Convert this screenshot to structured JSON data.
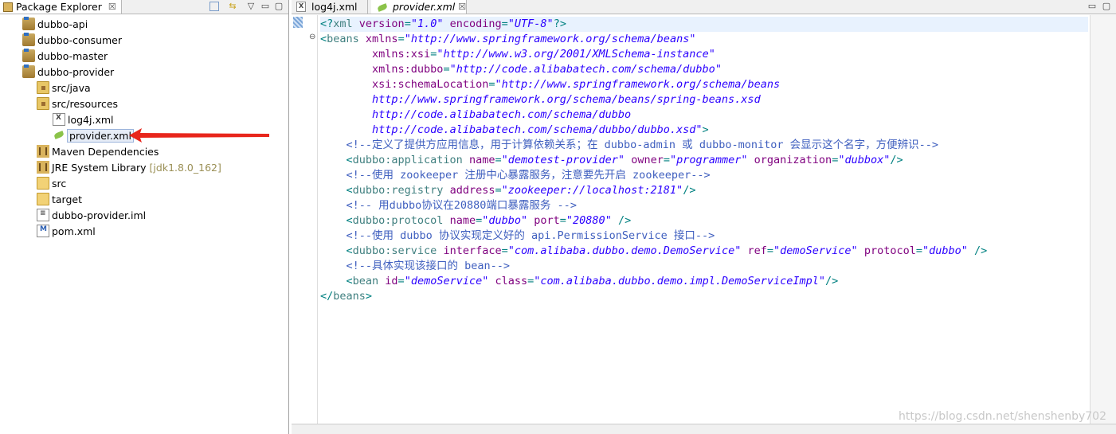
{
  "explorer": {
    "title": "Package Explorer",
    "close_glyph": "☒",
    "items": [
      {
        "label": "dubbo-api",
        "icon": "project-icon"
      },
      {
        "label": "dubbo-consumer",
        "icon": "project-icon"
      },
      {
        "label": "dubbo-master",
        "icon": "project-icon"
      },
      {
        "label": "dubbo-provider",
        "icon": "project-icon"
      },
      {
        "label": "src/java",
        "icon": "package-folder-icon"
      },
      {
        "label": "src/resources",
        "icon": "package-folder-icon"
      },
      {
        "label": "log4j.xml",
        "icon": "xml-file-icon"
      },
      {
        "label": "provider.xml",
        "icon": "xml-leaf-icon"
      },
      {
        "label": "Maven Dependencies",
        "icon": "library-icon"
      },
      {
        "label": "JRE System Library",
        "extra": "[jdk1.8.0_162]",
        "icon": "library-icon"
      },
      {
        "label": "src",
        "icon": "folder-icon"
      },
      {
        "label": "target",
        "icon": "folder-icon"
      },
      {
        "label": "dubbo-provider.iml",
        "icon": "file-icon"
      },
      {
        "label": "pom.xml",
        "icon": "maven-file-icon"
      }
    ]
  },
  "editor": {
    "tabs": [
      {
        "label": "log4j.xml",
        "icon": "xml-file-icon"
      },
      {
        "label": "provider.xml",
        "icon": "xml-leaf-icon"
      }
    ],
    "watermark": "https://blog.csdn.net/shenshenby702"
  },
  "code": [
    [
      [
        "p",
        "<?"
      ],
      [
        "tag",
        "xml "
      ],
      [
        "attr",
        "version"
      ],
      [
        "p",
        "="
      ],
      [
        "val",
        "\"1.0\""
      ],
      [
        "p",
        " "
      ],
      [
        "attr",
        "encoding"
      ],
      [
        "p",
        "="
      ],
      [
        "val",
        "\"UTF-8\""
      ],
      [
        "p",
        "?>"
      ]
    ],
    [
      [
        "p",
        "<"
      ],
      [
        "tag",
        "beans "
      ],
      [
        "attr",
        "xmlns"
      ],
      [
        "p",
        "="
      ],
      [
        "val",
        "\"http://www.springframework.org/schema/beans\""
      ]
    ],
    [
      [
        "p",
        "        "
      ],
      [
        "attr",
        "xmlns:xsi"
      ],
      [
        "p",
        "="
      ],
      [
        "val",
        "\"http://www.w3.org/2001/XMLSchema-instance\""
      ]
    ],
    [
      [
        "p",
        "        "
      ],
      [
        "attr",
        "xmlns:dubbo"
      ],
      [
        "p",
        "="
      ],
      [
        "val",
        "\"http://code.alibabatech.com/schema/dubbo\""
      ]
    ],
    [
      [
        "p",
        "        "
      ],
      [
        "attr",
        "xsi:schemaLocation"
      ],
      [
        "p",
        "="
      ],
      [
        "val",
        "\"http://www.springframework.org/schema/beans"
      ]
    ],
    [
      [
        "p",
        "        "
      ],
      [
        "val",
        "http://www.springframework.org/schema/beans/spring-beans.xsd"
      ]
    ],
    [
      [
        "p",
        "        "
      ],
      [
        "val",
        "http://code.alibabatech.com/schema/dubbo"
      ]
    ],
    [
      [
        "p",
        "        "
      ],
      [
        "val",
        "http://code.alibabatech.com/schema/dubbo/dubbo.xsd\""
      ],
      [
        "p",
        ">"
      ]
    ],
    [
      [
        "p",
        "    "
      ],
      [
        "com",
        "<!--定义了提供方应用信息，用于计算依赖关系；在 dubbo-admin 或 dubbo-monitor 会显示这个名字，方便辨识-->"
      ]
    ],
    [
      [
        "p",
        "    <"
      ],
      [
        "tag",
        "dubbo:application "
      ],
      [
        "attr",
        "name"
      ],
      [
        "p",
        "="
      ],
      [
        "val",
        "\"demotest-provider\""
      ],
      [
        "p",
        " "
      ],
      [
        "attr",
        "owner"
      ],
      [
        "p",
        "="
      ],
      [
        "val",
        "\"programmer\""
      ],
      [
        "p",
        " "
      ],
      [
        "attr",
        "organization"
      ],
      [
        "p",
        "="
      ],
      [
        "val",
        "\"dubbox\""
      ],
      [
        "p",
        "/>"
      ]
    ],
    [
      [
        "p",
        "    "
      ],
      [
        "com",
        "<!--使用 zookeeper 注册中心暴露服务，注意要先开启 zookeeper-->"
      ]
    ],
    [
      [
        "p",
        "    <"
      ],
      [
        "tag",
        "dubbo:registry "
      ],
      [
        "attr",
        "address"
      ],
      [
        "p",
        "="
      ],
      [
        "val",
        "\"zookeeper://localhost:2181\""
      ],
      [
        "p",
        "/>"
      ]
    ],
    [
      [
        "p",
        "    "
      ],
      [
        "com",
        "<!-- 用dubbo协议在20880端口暴露服务 -->"
      ]
    ],
    [
      [
        "p",
        "    <"
      ],
      [
        "tag",
        "dubbo:protocol "
      ],
      [
        "attr",
        "name"
      ],
      [
        "p",
        "="
      ],
      [
        "val",
        "\"dubbo\""
      ],
      [
        "p",
        " "
      ],
      [
        "attr",
        "port"
      ],
      [
        "p",
        "="
      ],
      [
        "val",
        "\"20880\""
      ],
      [
        "p",
        " />"
      ]
    ],
    [
      [
        "p",
        "    "
      ],
      [
        "com",
        "<!--使用 dubbo 协议实现定义好的 api.PermissionService 接口-->"
      ]
    ],
    [
      [
        "p",
        "    <"
      ],
      [
        "tag",
        "dubbo:service "
      ],
      [
        "attr",
        "interface"
      ],
      [
        "p",
        "="
      ],
      [
        "val",
        "\"com.alibaba.dubbo.demo.DemoService\""
      ],
      [
        "p",
        " "
      ],
      [
        "attr",
        "ref"
      ],
      [
        "p",
        "="
      ],
      [
        "val",
        "\"demoService\""
      ],
      [
        "p",
        " "
      ],
      [
        "attr",
        "protocol"
      ],
      [
        "p",
        "="
      ],
      [
        "val",
        "\"dubbo\""
      ],
      [
        "p",
        " />"
      ]
    ],
    [
      [
        "p",
        "    "
      ],
      [
        "com",
        "<!--具体实现该接口的 bean-->"
      ]
    ],
    [
      [
        "p",
        "    <"
      ],
      [
        "tag",
        "bean "
      ],
      [
        "attr",
        "id"
      ],
      [
        "p",
        "="
      ],
      [
        "val",
        "\"demoService\""
      ],
      [
        "p",
        " "
      ],
      [
        "attr",
        "class"
      ],
      [
        "p",
        "="
      ],
      [
        "val",
        "\"com.alibaba.dubbo.demo.impl.DemoServiceImpl\""
      ],
      [
        "p",
        "/>"
      ]
    ],
    [
      [
        "p",
        "</"
      ],
      [
        "tag",
        "beans"
      ],
      [
        "p",
        ">"
      ]
    ]
  ]
}
